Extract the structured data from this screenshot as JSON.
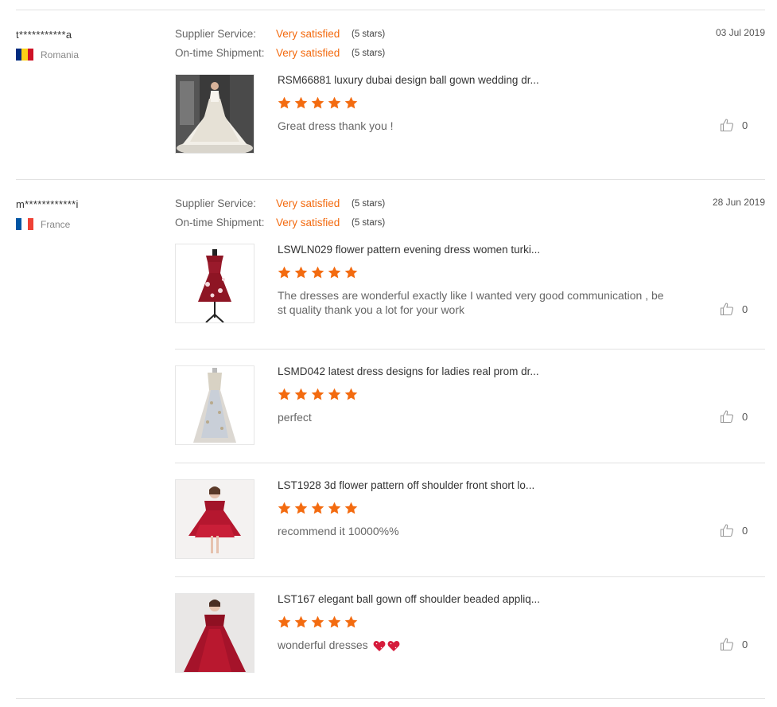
{
  "reviews": [
    {
      "buyer": "t***********a",
      "country": "Romania",
      "flag": [
        "#002b7f",
        "#fcd116",
        "#ce1126"
      ],
      "date": "03 Jul 2019",
      "ratings": [
        {
          "label": "Supplier Service:",
          "value": "Very satisfied",
          "stars": "(5 stars)"
        },
        {
          "label": "On-time Shipment:",
          "value": "Very satisfied",
          "stars": "(5 stars)"
        }
      ],
      "products": [
        {
          "name": "RSM66881 luxury dubai design ball gown wedding dr...",
          "rating": 5,
          "comment": "Great  dress thank you !",
          "likes": "0",
          "image": "white-ball-gown-photo"
        }
      ]
    },
    {
      "buyer": "m************i",
      "country": "France",
      "flag": [
        "#0055a4",
        "#ffffff",
        "#ef4135"
      ],
      "date": "28 Jun 2019",
      "ratings": [
        {
          "label": "Supplier Service:",
          "value": "Very satisfied",
          "stars": "(5 stars)"
        },
        {
          "label": "On-time Shipment:",
          "value": "Very satisfied",
          "stars": "(5 stars)"
        }
      ],
      "products": [
        {
          "name": "LSWLN029 flower pattern evening dress women turki...",
          "rating": 5,
          "comment": "The dresses are wonderful exactly like I wanted very good communication , be\nst quality thank you a lot for your work",
          "likes": "0",
          "image": "burgundy-floral-dress-photo"
        },
        {
          "name": "LSMD042 latest dress designs for ladies real prom dr...",
          "rating": 5,
          "comment": "perfect",
          "likes": "0",
          "image": "champagne-lace-gown-photo"
        },
        {
          "name": "LST1928 3d flower pattern off shoulder front short lo...",
          "rating": 5,
          "comment": "recommend it 10000%%",
          "likes": "0",
          "image": "red-girl-hi-lo-dress-photo"
        },
        {
          "name": "LST167 elegant ball gown off shoulder beaded appliq...",
          "rating": 5,
          "comment": "wonderful dresses",
          "comment_emoji": [
            "sparkling-heart-icon",
            "sparkling-heart-icon"
          ],
          "likes": "0",
          "image": "red-girl-ball-gown-photo"
        }
      ]
    }
  ],
  "colors": {
    "accent": "#f36b10",
    "divider": "#e2e2e2"
  }
}
